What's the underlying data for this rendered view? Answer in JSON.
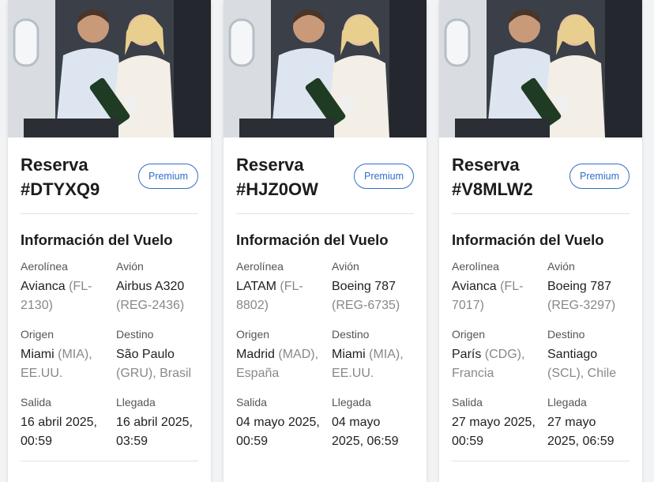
{
  "labels": {
    "section_title": "Información del Vuelo",
    "airline": "Aerolínea",
    "aircraft": "Avión",
    "origin": "Origen",
    "destination": "Destino",
    "departure": "Salida",
    "arrival": "Llegada",
    "reserva_prefix": "Reserva"
  },
  "bookings": [
    {
      "code": "#DTYXQ9",
      "badge": "Premium",
      "airline": "Avianca",
      "flight": "(FL-2130)",
      "aircraft": "Airbus A320",
      "registration": "(REG-2436)",
      "origin_city": "Miami",
      "origin_rest": "(MIA), EE.UU.",
      "dest_city": "São Paulo",
      "dest_rest": "(GRU), Brasil",
      "departure": "16 abril 2025, 00:59",
      "arrival": "16 abril 2025, 03:59"
    },
    {
      "code": "#HJZ0OW",
      "badge": "Premium",
      "airline": "LATAM",
      "flight": "(FL-8802)",
      "aircraft": "Boeing 787",
      "registration": "(REG-6735)",
      "origin_city": "Madrid",
      "origin_rest": "(MAD), España",
      "dest_city": "Miami",
      "dest_rest": "(MIA), EE.UU.",
      "departure": "04 mayo 2025, 00:59",
      "arrival": "04 mayo 2025, 06:59"
    },
    {
      "code": "#V8MLW2",
      "badge": "Premium",
      "airline": "Avianca",
      "flight": "(FL-7017)",
      "aircraft": "Boeing 787",
      "registration": "(REG-3297)",
      "origin_city": "París",
      "origin_rest": "(CDG), Francia",
      "dest_city": "Santiago",
      "dest_rest": "(SCL), Chile",
      "departure": "27 mayo 2025, 00:59",
      "arrival": "27 mayo 2025, 06:59"
    }
  ],
  "colors": {
    "accent": "#2f6fc8",
    "muted": "#888888"
  }
}
